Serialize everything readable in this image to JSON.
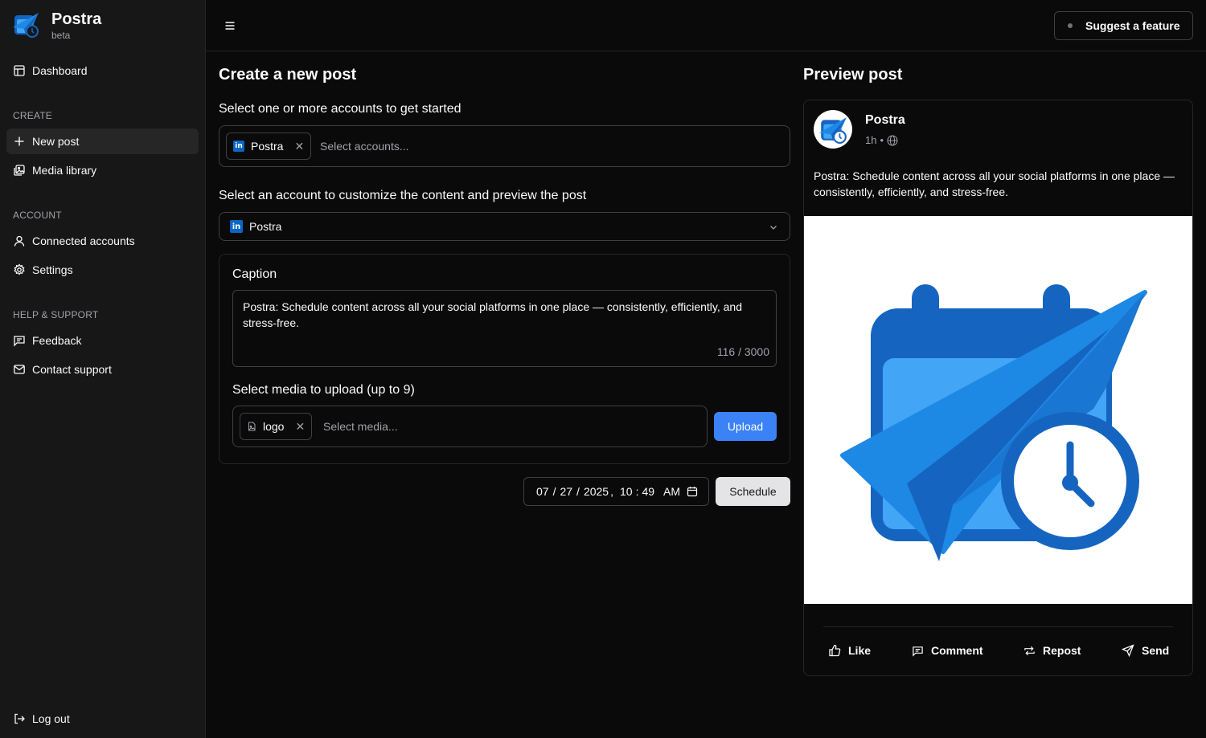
{
  "brand": {
    "name": "Postra",
    "tag": "beta"
  },
  "sidebar": {
    "dashboard": "Dashboard",
    "sections": {
      "create": "CREATE",
      "account": "ACCOUNT",
      "help": "HELP & SUPPORT"
    },
    "new_post": "New post",
    "media_library": "Media library",
    "connected_accounts": "Connected accounts",
    "settings": "Settings",
    "feedback": "Feedback",
    "contact_support": "Contact support",
    "logout": "Log out"
  },
  "topbar": {
    "suggest_label": "Suggest a feature"
  },
  "compose": {
    "title": "Create a new post",
    "accounts_label": "Select one or more accounts to get started",
    "selected_account_chip": "Postra",
    "accounts_placeholder": "Select accounts...",
    "customize_label": "Select an account to customize the content and preview the post",
    "customize_selected": "Postra",
    "caption_label": "Caption",
    "caption_text": "Postra: Schedule content across all your social platforms in one place — consistently, efficiently, and stress-free.",
    "caption_count": "116 / 3000",
    "media_label": "Select media to upload (up to 9)",
    "media_chip": "logo",
    "media_placeholder": "Select media...",
    "upload_label": "Upload",
    "date": {
      "month": "07",
      "day": "27",
      "year": "2025",
      "hour": "10",
      "minute": "49",
      "ampm": "AM"
    },
    "schedule_label": "Schedule"
  },
  "preview": {
    "title": "Preview post",
    "author": "Postra",
    "time": "1h",
    "text": "Postra: Schedule content across all your social platforms in one place — consistently, efficiently, and stress-free.",
    "actions": {
      "like": "Like",
      "comment": "Comment",
      "repost": "Repost",
      "send": "Send"
    }
  },
  "colors": {
    "accent": "#3b82f6",
    "brand_blue": "#1e88e5",
    "linkedin": "#0a66c2"
  }
}
